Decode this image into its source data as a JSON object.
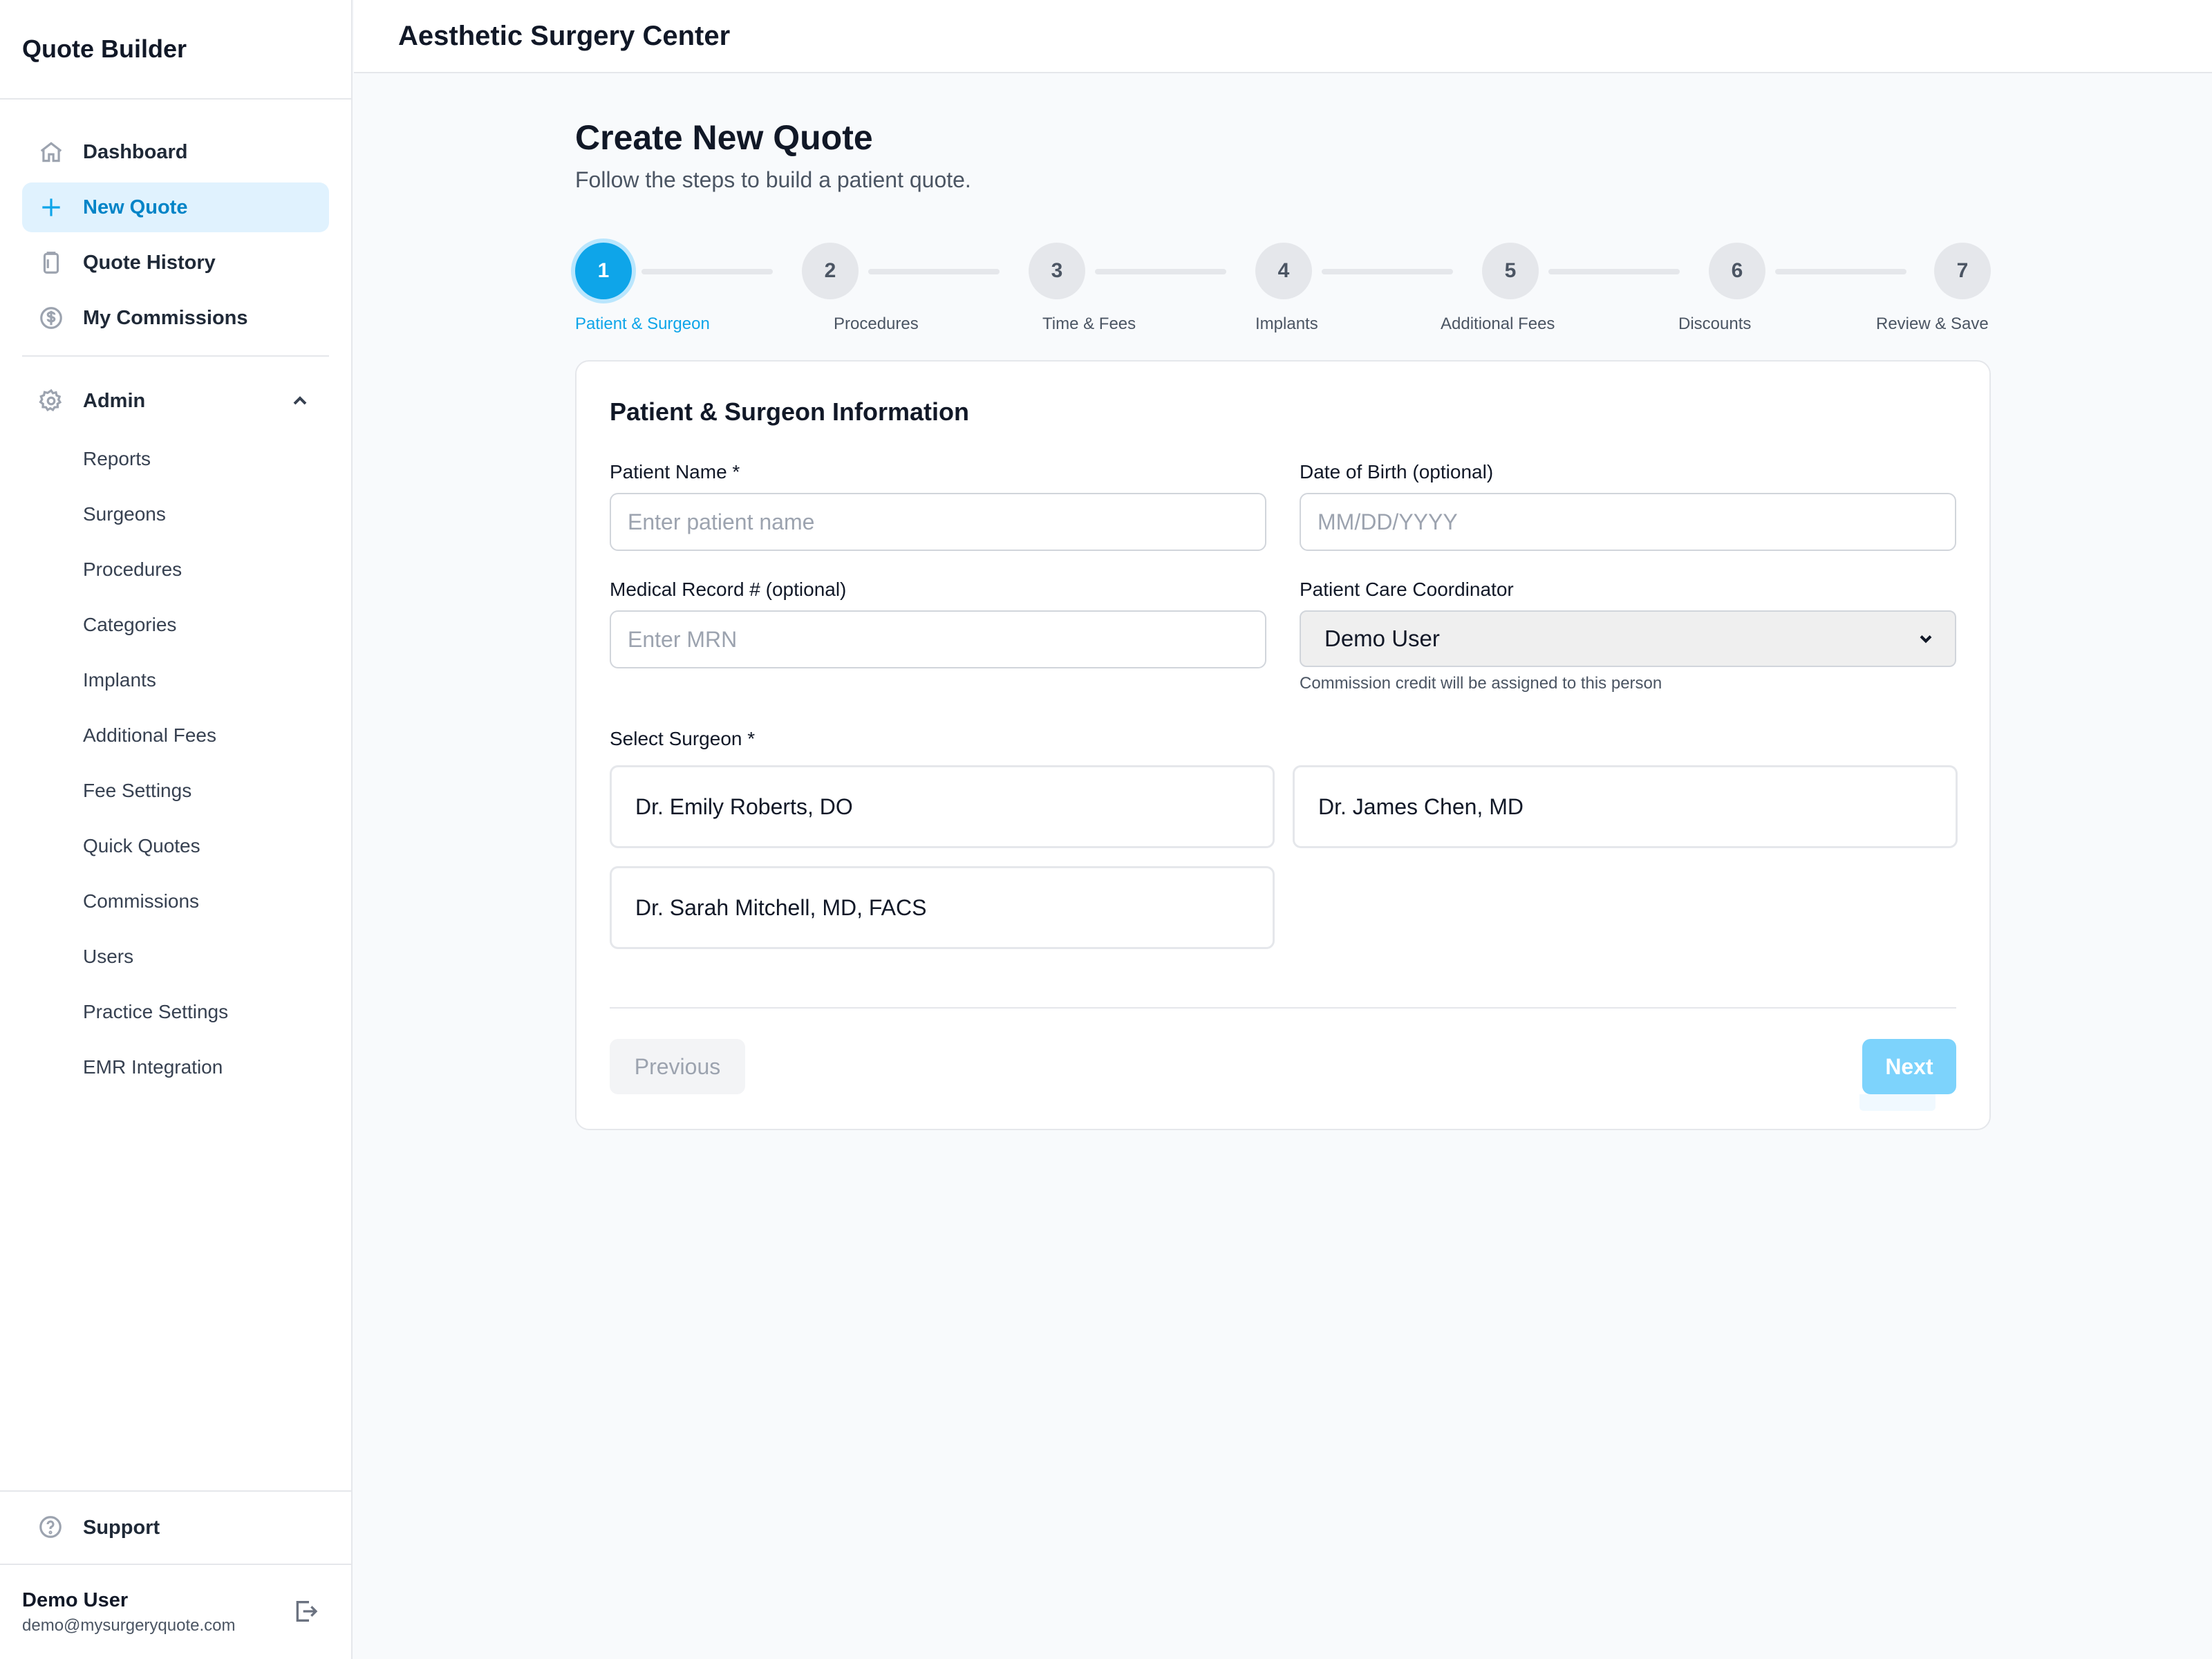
{
  "app": {
    "title": "Quote Builder"
  },
  "header": {
    "title": "Aesthetic Surgery Center"
  },
  "sidebar": {
    "items": [
      {
        "label": "Dashboard",
        "icon": "home-icon",
        "active": false
      },
      {
        "label": "New Quote",
        "icon": "plus-icon",
        "active": true
      },
      {
        "label": "Quote History",
        "icon": "clipboard-icon",
        "active": false
      },
      {
        "label": "My Commissions",
        "icon": "dollar-circle-icon",
        "active": false
      }
    ],
    "admin": {
      "label": "Admin",
      "icon": "gear-icon",
      "expanded": true,
      "items": [
        "Reports",
        "Surgeons",
        "Procedures",
        "Categories",
        "Implants",
        "Additional Fees",
        "Fee Settings",
        "Quick Quotes",
        "Commissions",
        "Users",
        "Practice Settings",
        "EMR Integration"
      ]
    },
    "support": {
      "label": "Support",
      "icon": "help-circle-icon"
    },
    "user": {
      "name": "Demo User",
      "email": "demo@mysurgeryquote.com"
    }
  },
  "main": {
    "title": "Create New Quote",
    "subtitle": "Follow the steps to build a patient quote.",
    "steps": [
      {
        "number": "1",
        "label": "Patient & Surgeon",
        "active": true
      },
      {
        "number": "2",
        "label": "Procedures",
        "active": false
      },
      {
        "number": "3",
        "label": "Time & Fees",
        "active": false
      },
      {
        "number": "4",
        "label": "Implants",
        "active": false
      },
      {
        "number": "5",
        "label": "Additional Fees",
        "active": false
      },
      {
        "number": "6",
        "label": "Discounts",
        "active": false
      },
      {
        "number": "7",
        "label": "Review & Save",
        "active": false
      }
    ],
    "form": {
      "title": "Patient & Surgeon Information",
      "patient_name": {
        "label": "Patient Name *",
        "placeholder": "Enter patient name",
        "value": ""
      },
      "dob": {
        "label": "Date of Birth (optional)",
        "placeholder": "MM/DD/YYYY",
        "value": ""
      },
      "mrn": {
        "label": "Medical Record # (optional)",
        "placeholder": "Enter MRN",
        "value": ""
      },
      "coordinator": {
        "label": "Patient Care Coordinator",
        "selected": "Demo User",
        "hint": "Commission credit will be assigned to this person"
      },
      "surgeon": {
        "label": "Select Surgeon *",
        "options": [
          "Dr. Emily Roberts, DO",
          "Dr. James Chen, MD",
          "Dr. Sarah Mitchell, MD, FACS"
        ]
      },
      "previous_label": "Previous",
      "next_label": "Next"
    }
  },
  "colors": {
    "accent": "#0ea5e9",
    "accent_light": "#e0f2fe",
    "next_disabled": "#7dd3fc"
  }
}
